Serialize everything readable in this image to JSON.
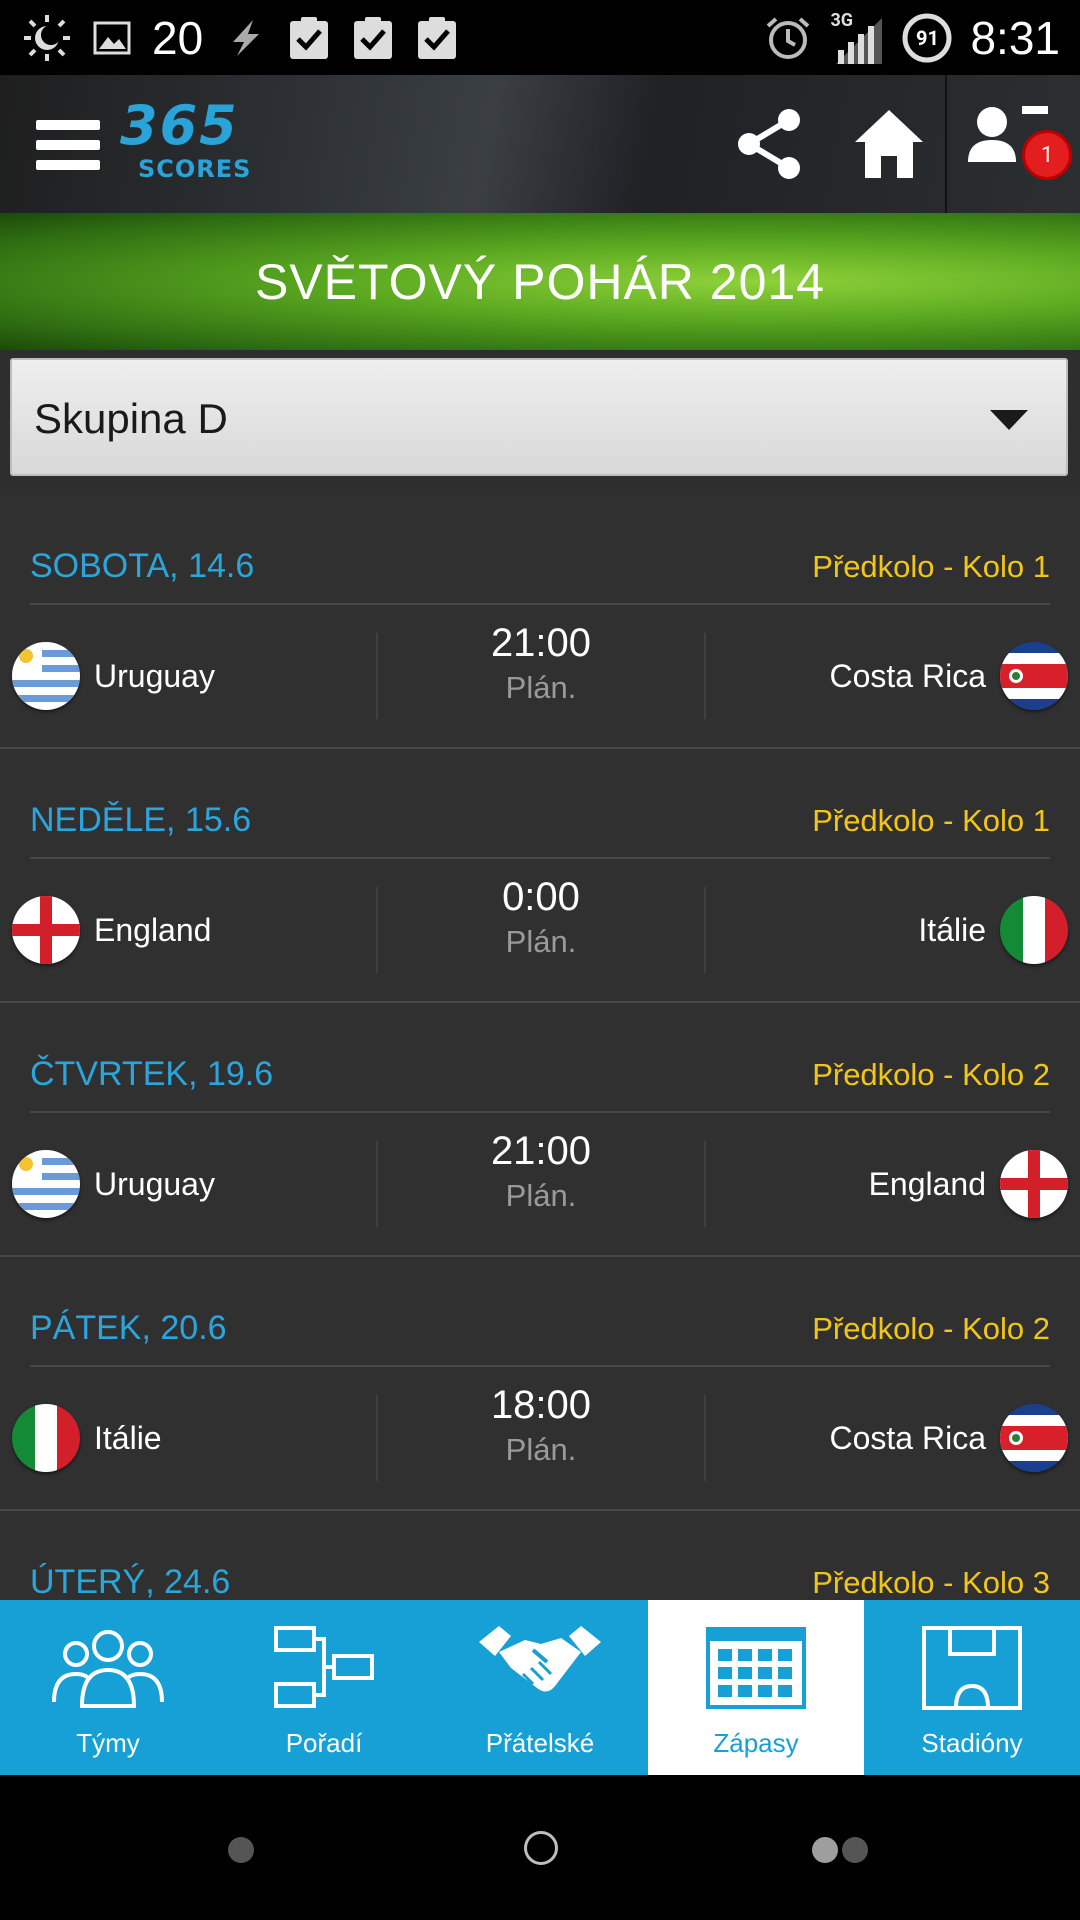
{
  "status_bar": {
    "notification_count": "20",
    "signal_type": "3G",
    "battery": "91",
    "time": "8:31",
    "icons": [
      "brightness-icon",
      "gallery-icon",
      "flash-icon",
      "clipboard-check-icon",
      "clipboard-check-icon",
      "clipboard-check-icon",
      "alarm-icon",
      "signal-icon",
      "battery-icon"
    ]
  },
  "app_bar": {
    "logo_number": "365",
    "logo_sub": "SCORES",
    "notification_badge": "1"
  },
  "banner": {
    "title": "SVĚTOVÝ POHÁR 2014"
  },
  "group_selector": {
    "selected": "Skupina D"
  },
  "days": [
    {
      "date": "SOBOTA, 14.6",
      "round": "Předkolo - Kolo 1",
      "home": "Uruguay",
      "home_flag": "uruguay",
      "time": "21:00",
      "status": "Plán.",
      "away": "Costa Rica",
      "away_flag": "costa-rica"
    },
    {
      "date": "NEDĚLE, 15.6",
      "round": "Předkolo - Kolo 1",
      "home": "England",
      "home_flag": "england",
      "time": "0:00",
      "status": "Plán.",
      "away": "Itálie",
      "away_flag": "italy"
    },
    {
      "date": "ČTVRTEK, 19.6",
      "round": "Předkolo - Kolo 2",
      "home": "Uruguay",
      "home_flag": "uruguay",
      "time": "21:00",
      "status": "Plán.",
      "away": "England",
      "away_flag": "england"
    },
    {
      "date": "PÁTEK, 20.6",
      "round": "Předkolo - Kolo 2",
      "home": "Itálie",
      "home_flag": "italy",
      "time": "18:00",
      "status": "Plán.",
      "away": "Costa Rica",
      "away_flag": "costa-rica"
    },
    {
      "date": "ÚTERÝ, 24.6",
      "round": "Předkolo - Kolo 3"
    }
  ],
  "tabs": [
    {
      "label": "Týmy",
      "icon": "teams-icon",
      "active": false
    },
    {
      "label": "Pořadí",
      "icon": "standings-icon",
      "active": false
    },
    {
      "label": "Přátelské",
      "icon": "handshake-icon",
      "active": false
    },
    {
      "label": "Zápasy",
      "icon": "calendar-icon",
      "active": true
    },
    {
      "label": "Stadióny",
      "icon": "stadium-icon",
      "active": false
    }
  ],
  "colors": {
    "accent_blue": "#17a0d6",
    "date_blue": "#2aa6dc",
    "round_yellow": "#f2c618",
    "badge_red": "#e41e1e"
  }
}
